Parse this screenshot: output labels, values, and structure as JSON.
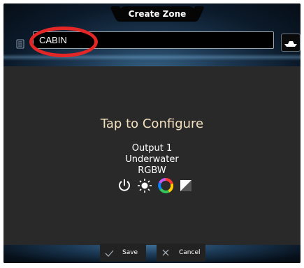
{
  "header": {
    "title": "Create Zone",
    "zone_name_value": "CABIN",
    "menu_icon": "menu-icon",
    "boat_icon": "boat-icon"
  },
  "main": {
    "instruction": "Tap to Configure",
    "output_name": "Output 1",
    "output_location": "Underwater",
    "output_type": "RGBW",
    "mode_icons": [
      "power-icon",
      "brightness-icon",
      "color-wheel-icon",
      "white-balance-icon"
    ]
  },
  "footer": {
    "save_label": "Save",
    "cancel_label": "Cancel",
    "save_icon": "checkmark-icon",
    "cancel_icon": "close-icon"
  },
  "colors": {
    "accent_highlight": "#e32626",
    "instruction_text": "#f3e0bf",
    "header_blue": "#3b6a8f"
  }
}
